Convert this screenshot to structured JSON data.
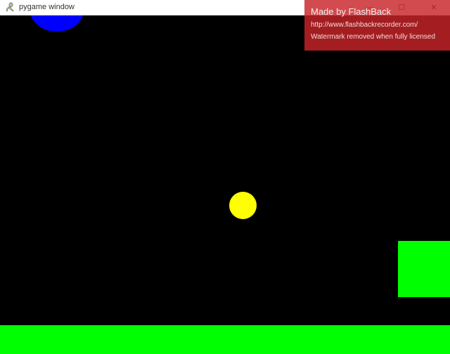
{
  "window": {
    "title": "pygame window",
    "controls": {
      "minimize": "—",
      "maximize": "☐",
      "close": "✕"
    }
  },
  "watermark": {
    "title": "Made by FlashBack",
    "url": "http://www.flashbackrecorder.com/",
    "notice": "Watermark removed when fully licensed"
  },
  "game": {
    "background_color": "#000000",
    "objects": [
      {
        "name": "blue-ball",
        "color": "#0000ff",
        "shape": "circle"
      },
      {
        "name": "yellow-ball",
        "color": "#ffff00",
        "shape": "circle"
      },
      {
        "name": "green-block",
        "color": "#00ff00",
        "shape": "rectangle"
      },
      {
        "name": "ground",
        "color": "#00ff00",
        "shape": "rectangle"
      }
    ]
  }
}
